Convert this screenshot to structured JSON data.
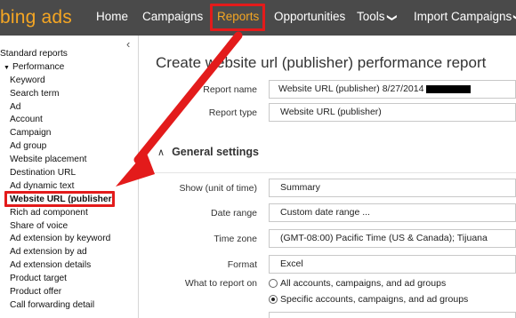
{
  "topbar": {
    "logo": "bing ads",
    "nav": [
      {
        "label": "Home"
      },
      {
        "label": "Campaigns"
      },
      {
        "label": "Reports"
      },
      {
        "label": "Opportunities"
      },
      {
        "label": "Tools",
        "caret": "❯"
      },
      {
        "label": "Import Campaigns",
        "caret": "❯"
      }
    ]
  },
  "sidebar": {
    "collapse_glyph": "‹",
    "items": [
      {
        "label": "Standard reports",
        "level": 0
      },
      {
        "label": "Performance",
        "level": 1,
        "expanded_glyph": "▼"
      },
      {
        "label": "Keyword",
        "level": 2
      },
      {
        "label": "Search term",
        "level": 2
      },
      {
        "label": "Ad",
        "level": 2
      },
      {
        "label": "Account",
        "level": 2
      },
      {
        "label": "Campaign",
        "level": 2
      },
      {
        "label": "Ad group",
        "level": 2
      },
      {
        "label": "Website placement",
        "level": 2
      },
      {
        "label": "Destination URL",
        "level": 2
      },
      {
        "label": "Ad dynamic text",
        "level": 2
      },
      {
        "label": "Website URL (publisher)",
        "level": 2,
        "selected": true
      },
      {
        "label": "Rich ad component",
        "level": 2
      },
      {
        "label": "Share of voice",
        "level": 2
      },
      {
        "label": "Ad extension by keyword",
        "level": 2
      },
      {
        "label": "Ad extension by ad",
        "level": 2
      },
      {
        "label": "Ad extension details",
        "level": 2
      },
      {
        "label": "Product target",
        "level": 2
      },
      {
        "label": "Product offer",
        "level": 2
      },
      {
        "label": "Call forwarding detail",
        "level": 2
      }
    ]
  },
  "main": {
    "title": "Create website url (publisher) performance report",
    "report_name": {
      "label": "Report name",
      "value": "Website URL (publisher) 8/27/2014"
    },
    "report_type": {
      "label": "Report type",
      "value": "Website URL (publisher)"
    },
    "general_settings": {
      "heading": "General settings",
      "chevron": "∧",
      "show_unit": {
        "label": "Show (unit of time)",
        "value": "Summary"
      },
      "date_range": {
        "label": "Date range",
        "value": "Custom date range ..."
      },
      "time_zone": {
        "label": "Time zone",
        "value": "(GMT-08:00) Pacific Time (US & Canada); Tijuana"
      },
      "format": {
        "label": "Format",
        "value": "Excel"
      },
      "what_to_report": {
        "label": "What to report on",
        "options": [
          {
            "label": "All accounts, campaigns, and ad groups",
            "checked": false
          },
          {
            "label": "Specific accounts, campaigns, and ad groups",
            "checked": true
          }
        ]
      }
    }
  },
  "colors": {
    "topbar_bg": "#4a4a4a",
    "brand_orange": "#f5a623",
    "annotation_red": "#e31b1b"
  }
}
